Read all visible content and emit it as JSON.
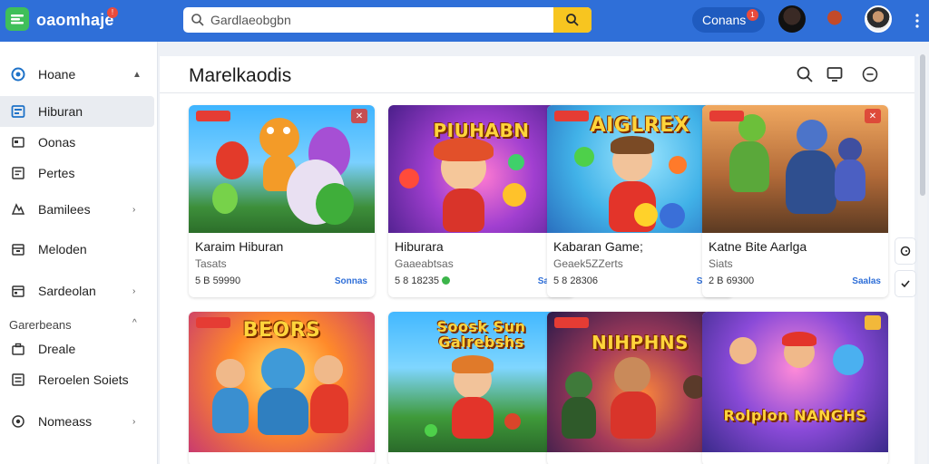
{
  "header": {
    "brand": "oaomhaje",
    "brand_badge": "!",
    "search_placeholder": "Gardlaeobgbn",
    "pill_label": "Conans",
    "pill_badge": "1"
  },
  "sidebar": {
    "items": [
      {
        "label": "Hoane",
        "icon": "home-icon",
        "chev": "▲"
      },
      {
        "label": "Hiburan",
        "icon": "category-icon"
      },
      {
        "label": "Oonas",
        "icon": "window-icon"
      },
      {
        "label": "Pertes",
        "icon": "document-icon"
      },
      {
        "label": "Bamilees",
        "icon": "puzzle-icon",
        "chev": "›"
      },
      {
        "label": "Meloden",
        "icon": "archive-icon"
      },
      {
        "label": "Sardeolan",
        "icon": "calendar-icon",
        "chev": "›"
      }
    ],
    "section_label": "Garerbeans",
    "section_chev": "^",
    "section_items": [
      {
        "label": "Dreale",
        "icon": "briefcase-icon"
      },
      {
        "label": "Reroelen Soiets",
        "icon": "list-icon"
      },
      {
        "label": "Nomeass",
        "icon": "globe-icon",
        "chev": "›"
      }
    ]
  },
  "main": {
    "title": "Marelkaodis"
  },
  "cards": [
    {
      "art_title": "",
      "name": "Karaim Hiburan",
      "sub": "Tasats",
      "price": "5 B 59990",
      "link": "Sonnas"
    },
    {
      "art_title": "PIUHABN",
      "name": "Hiburara",
      "sub": "Gaaeabtsas",
      "price": "5 8 18235",
      "link": "Saaats"
    },
    {
      "art_title": "AIGLREX",
      "name": "Kabaran Game;",
      "sub": "Geaek5ZZerts",
      "price": "5 8 28306",
      "link": "Saaats"
    },
    {
      "art_title": "",
      "name": "Katne Bite Aarlga",
      "sub": "Siats",
      "price": "2 B 69300",
      "link": "Saalas"
    },
    {
      "art_title": "BEORS",
      "name": "",
      "sub": "",
      "price": "",
      "link": ""
    },
    {
      "art_title": "Soosk Sun Galrebshs",
      "name": "",
      "sub": "",
      "price": "",
      "link": ""
    },
    {
      "art_title": "NIHPHNS",
      "name": "",
      "sub": "",
      "price": "",
      "link": ""
    },
    {
      "art_title": "Rolplon NANGHS",
      "name": "",
      "sub": "",
      "price": "",
      "link": ""
    }
  ],
  "colors": {
    "topbar": "#2f6fd8",
    "accent_yellow": "#f7c520",
    "badge_red": "#e94b3c",
    "link_blue": "#2f6fd8"
  }
}
